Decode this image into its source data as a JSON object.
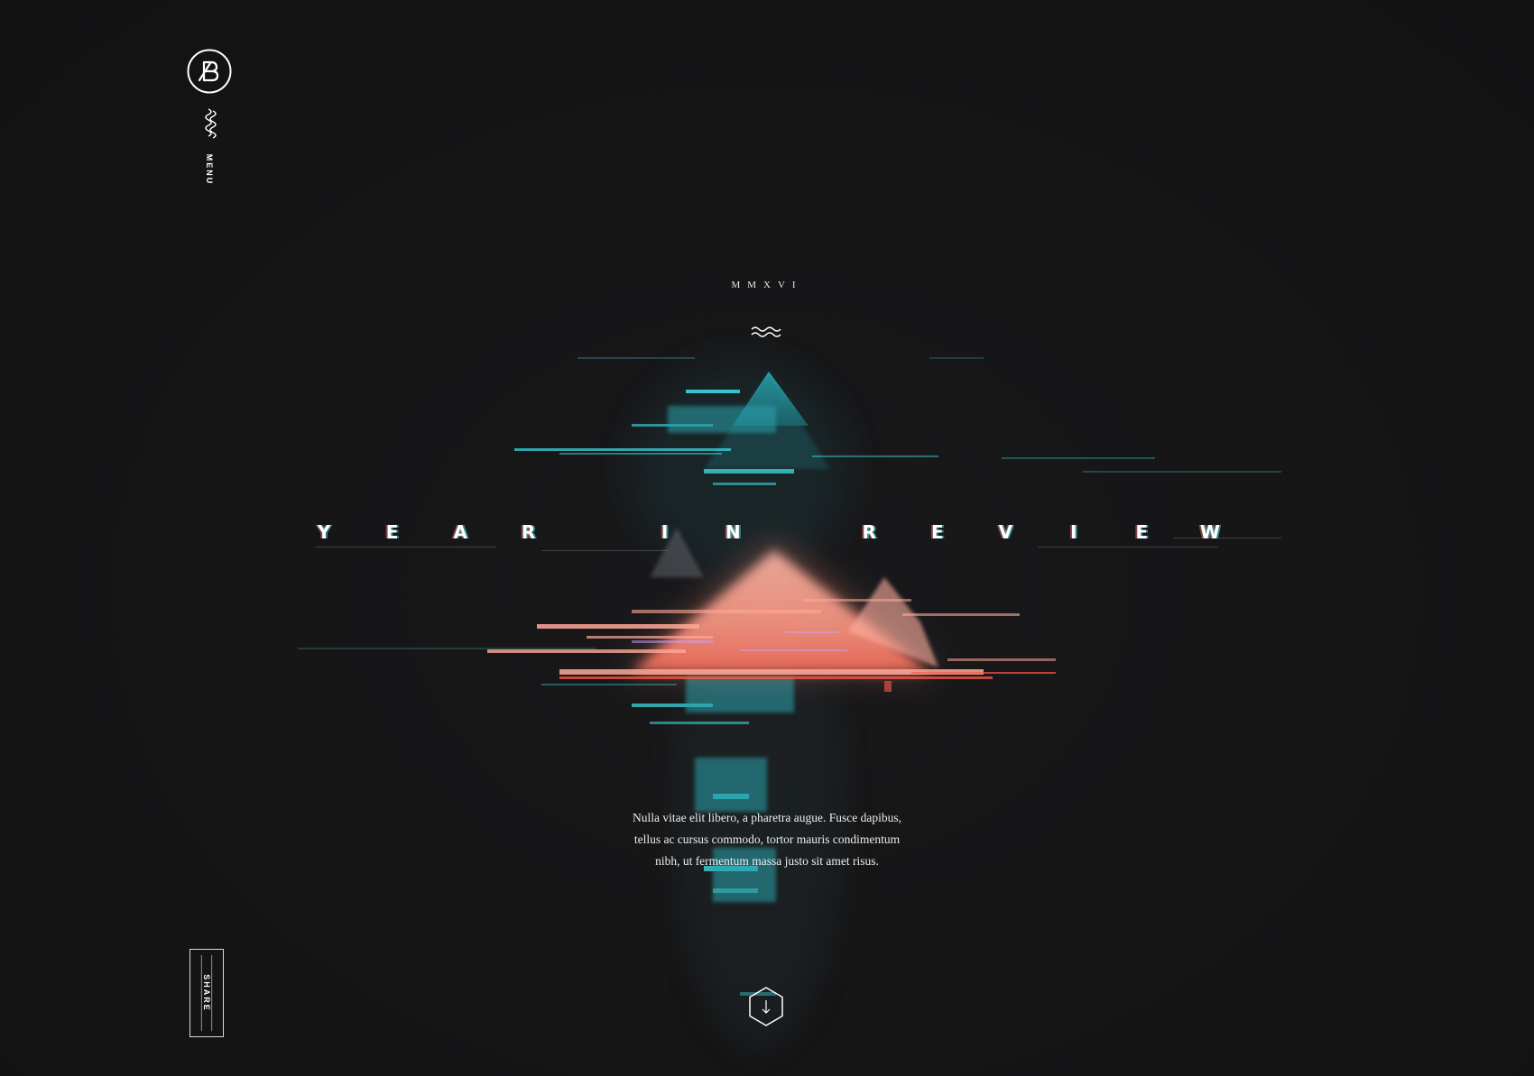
{
  "brand": {
    "logo_icon": "b-monogram-circle-icon"
  },
  "menu": {
    "icon": "wave-menu-icon",
    "label": "MENU"
  },
  "share": {
    "label": "SHARE"
  },
  "hero": {
    "year_roman": "MMXVI",
    "divider_icon": "wave-divider-icon",
    "title_letters": [
      "Y",
      "E",
      "A",
      "R",
      " ",
      "I",
      "N",
      " ",
      "R",
      "E",
      "V",
      "I",
      "E",
      "W"
    ],
    "title_text": "YEAR IN REVIEW",
    "description_lines": [
      "Nulla vitae elit libero, a pharetra augue. Fusce dapibus,",
      "tellus ac cursus commodo, tortor mauris condimentum",
      "nibh, ut fermentum massa justo sit amet risus."
    ],
    "scroll_icon": "hexagon-arrow-down-icon"
  },
  "colors": {
    "background": "#151516",
    "accent_cyan": "#3fe0e8",
    "accent_coral": "#ff9c8a",
    "text": "#ffffff"
  }
}
